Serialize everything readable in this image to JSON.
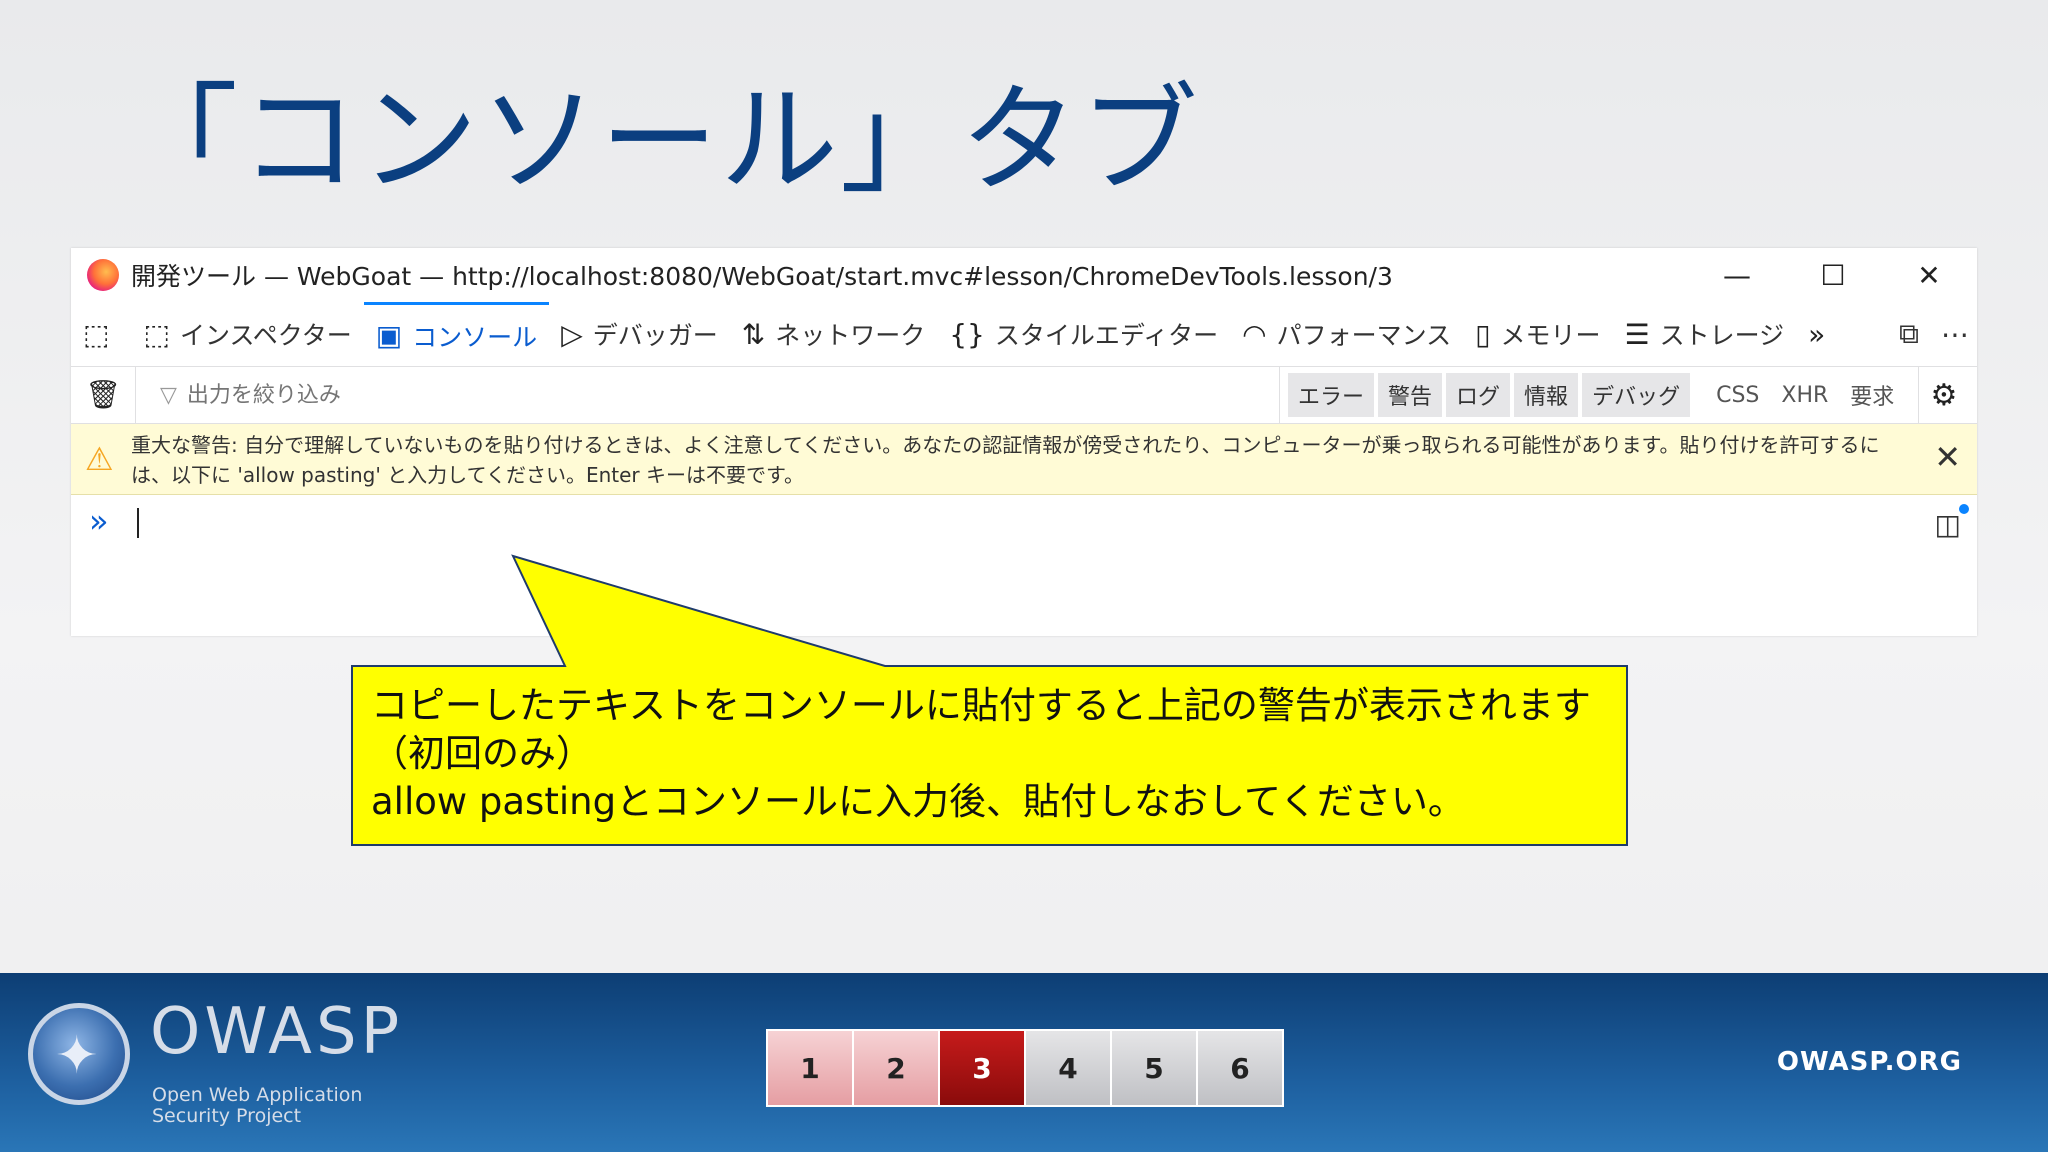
{
  "slide": {
    "title": "「コンソール」タブ"
  },
  "window": {
    "title": "開発ツール — WebGoat — http://localhost:8080/WebGoat/start.mvc#lesson/ChromeDevTools.lesson/3",
    "controls": {
      "minimize": "—",
      "maximize": "☐",
      "close": "✕"
    }
  },
  "toolbar": {
    "tabs": [
      {
        "label": "インスペクター",
        "icon": "inspector-icon"
      },
      {
        "label": "コンソール",
        "icon": "console-icon",
        "active": true
      },
      {
        "label": "デバッガー",
        "icon": "debugger-icon"
      },
      {
        "label": "ネットワーク",
        "icon": "network-icon"
      },
      {
        "label": "スタイルエディター",
        "icon": "style-editor-icon"
      },
      {
        "label": "パフォーマンス",
        "icon": "performance-icon"
      },
      {
        "label": "メモリー",
        "icon": "memory-icon"
      },
      {
        "label": "ストレージ",
        "icon": "storage-icon"
      }
    ]
  },
  "filterbar": {
    "placeholder": "出力を絞り込み",
    "levels": [
      "エラー",
      "警告",
      "ログ",
      "情報",
      "デバッグ"
    ],
    "requests": [
      "CSS",
      "XHR",
      "要求"
    ]
  },
  "warning": {
    "text": "重大な警告: 自分で理解していないものを貼り付けるときは、よく注意してください。あなたの認証情報が傍受されたり、コンピューターが乗っ取られる可能性があります。貼り付けを許可するには、以下に 'allow pasting' と入力してください。Enter キーは不要です。"
  },
  "console": {
    "prompt": "»"
  },
  "callout": {
    "line1": "コピーしたテキストをコンソールに貼付すると上記の警告が表示されます",
    "line2": "（初回のみ）",
    "line3": "allow pastingとコンソールに入力後、貼付しなおしてください。",
    "fill_color": "#ffff00",
    "border_color": "#1f3b6b"
  },
  "footer": {
    "logo_text": "OWASP",
    "logo_sub": "Open Web Application\nSecurity Project",
    "pages": [
      "1",
      "2",
      "3",
      "4",
      "5",
      "6"
    ],
    "current_page": "3",
    "site": "OWASP.ORG"
  }
}
